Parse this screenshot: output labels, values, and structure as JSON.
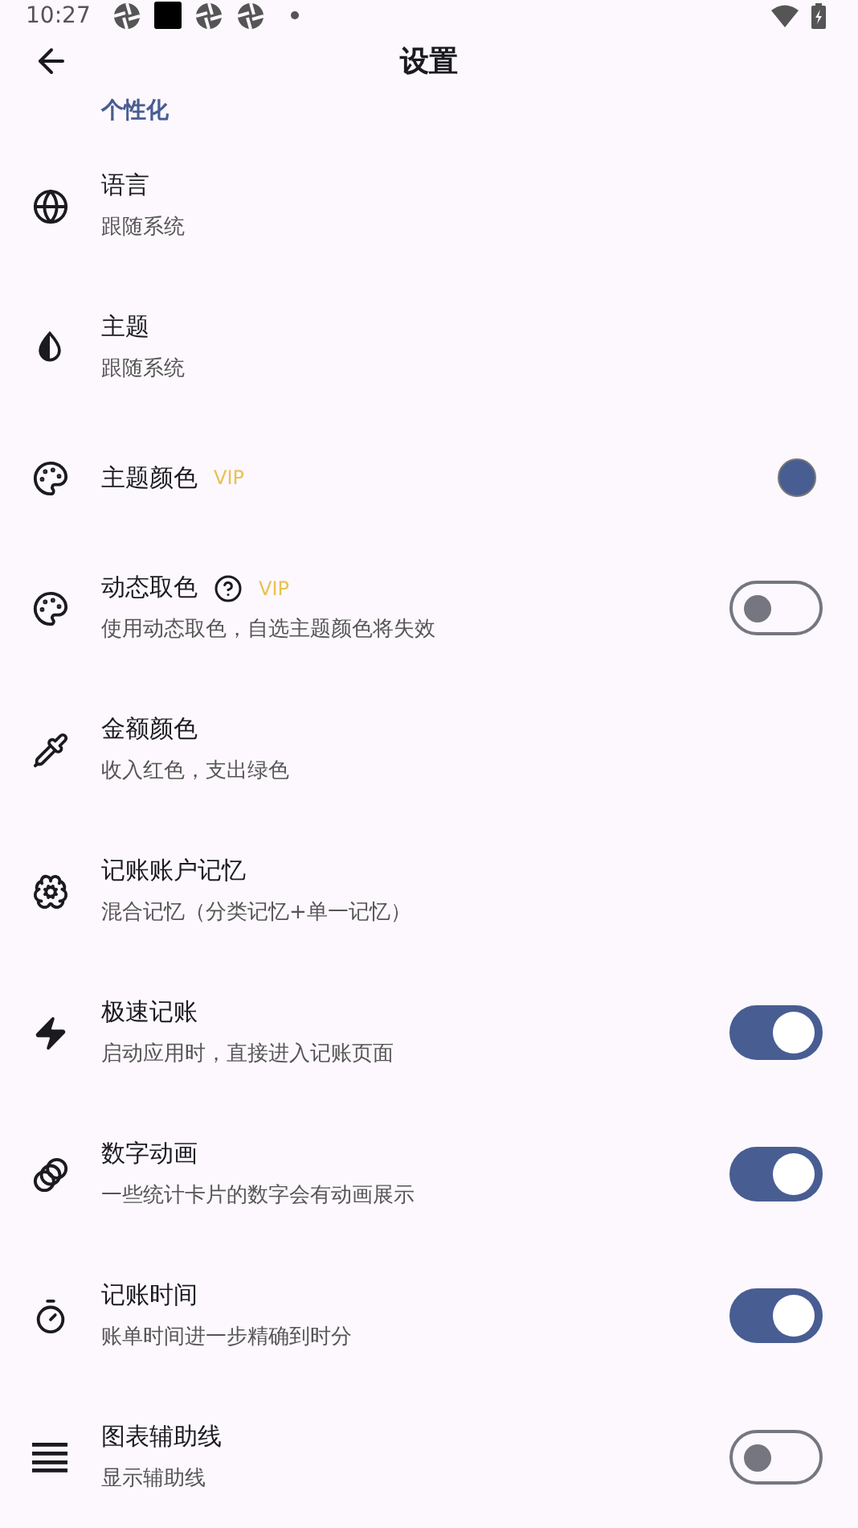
{
  "status_bar": {
    "time": "10:27"
  },
  "header": {
    "title": "设置"
  },
  "section": {
    "title": "个性化"
  },
  "rows": [
    {
      "kind": "plain",
      "title": "语言",
      "subtitle": "跟随系统"
    },
    {
      "kind": "plain",
      "title": "主题",
      "subtitle": "跟随系统"
    },
    {
      "kind": "color",
      "title": "主题颜色",
      "badge": "VIP",
      "color": "#485d92"
    },
    {
      "kind": "switch",
      "title": "动态取色",
      "help": true,
      "badge": "VIP",
      "subtitle": "使用动态取色，自选主题颜色将失效",
      "on": false
    },
    {
      "kind": "plain",
      "title": "金额颜色",
      "subtitle": "收入红色，支出绿色"
    },
    {
      "kind": "plain",
      "title": "记账账户记忆",
      "subtitle": "混合记忆（分类记忆+单一记忆）"
    },
    {
      "kind": "switch",
      "title": "极速记账",
      "subtitle": "启动应用时，直接进入记账页面",
      "on": true
    },
    {
      "kind": "switch",
      "title": "数字动画",
      "subtitle": "一些统计卡片的数字会有动画展示",
      "on": true
    },
    {
      "kind": "switch",
      "title": "记账时间",
      "subtitle": "账单时间进一步精确到时分",
      "on": true
    },
    {
      "kind": "switch",
      "title": "图表辅助线",
      "subtitle": "显示辅助线",
      "on": false
    }
  ]
}
